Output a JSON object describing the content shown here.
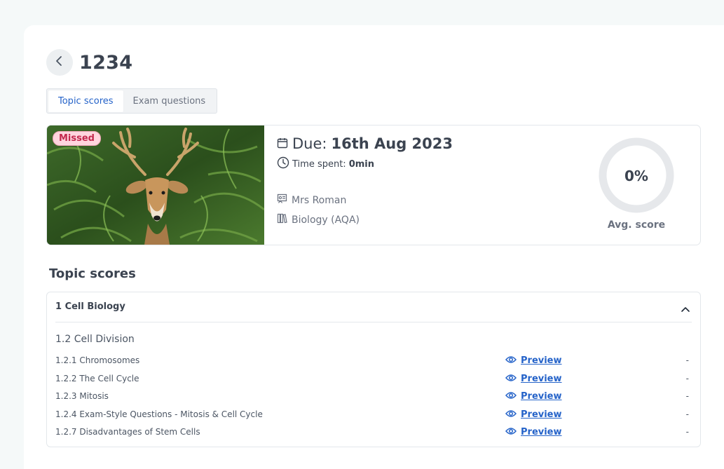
{
  "page": {
    "title": "1234"
  },
  "tabs": [
    {
      "label": "Topic scores",
      "active": true
    },
    {
      "label": "Exam questions",
      "active": false
    }
  ],
  "assignment": {
    "status_badge": "Missed",
    "due_label": "Due:",
    "due_date": "16th Aug 2023",
    "time_spent_label": "Time spent:",
    "time_spent_value": "0min",
    "teacher": "Mrs Roman",
    "subject": "Biology (AQA)",
    "avg_score_value": "0%",
    "avg_score_fraction": 0,
    "avg_score_label": "Avg. score"
  },
  "topic_scores": {
    "section_title": "Topic scores",
    "accordion_title": "1 Cell Biology",
    "subtopic_title": "1.2 Cell Division",
    "rows": [
      {
        "name": "1.2.1 Chromosomes",
        "preview": "Preview",
        "score": "-"
      },
      {
        "name": "1.2.2 The Cell Cycle",
        "preview": "Preview",
        "score": "-"
      },
      {
        "name": "1.2.3 Mitosis",
        "preview": "Preview",
        "score": "-"
      },
      {
        "name": "1.2.4 Exam-Style Questions - Mitosis & Cell Cycle",
        "preview": "Preview",
        "score": "-"
      },
      {
        "name": "1.2.7 Disadvantages of Stem Cells",
        "preview": "Preview",
        "score": "-"
      }
    ]
  },
  "colors": {
    "accent": "#2563c9",
    "badge_bg": "#ffd5de",
    "badge_text": "#c3294e",
    "gauge_track": "#e6e8eb"
  },
  "icons": {
    "back": "chevron-left-icon",
    "due": "calendar-icon",
    "time": "clock-icon",
    "teacher": "teacher-icon",
    "subject": "books-icon",
    "collapse": "chevron-up-icon",
    "preview": "eye-icon"
  }
}
